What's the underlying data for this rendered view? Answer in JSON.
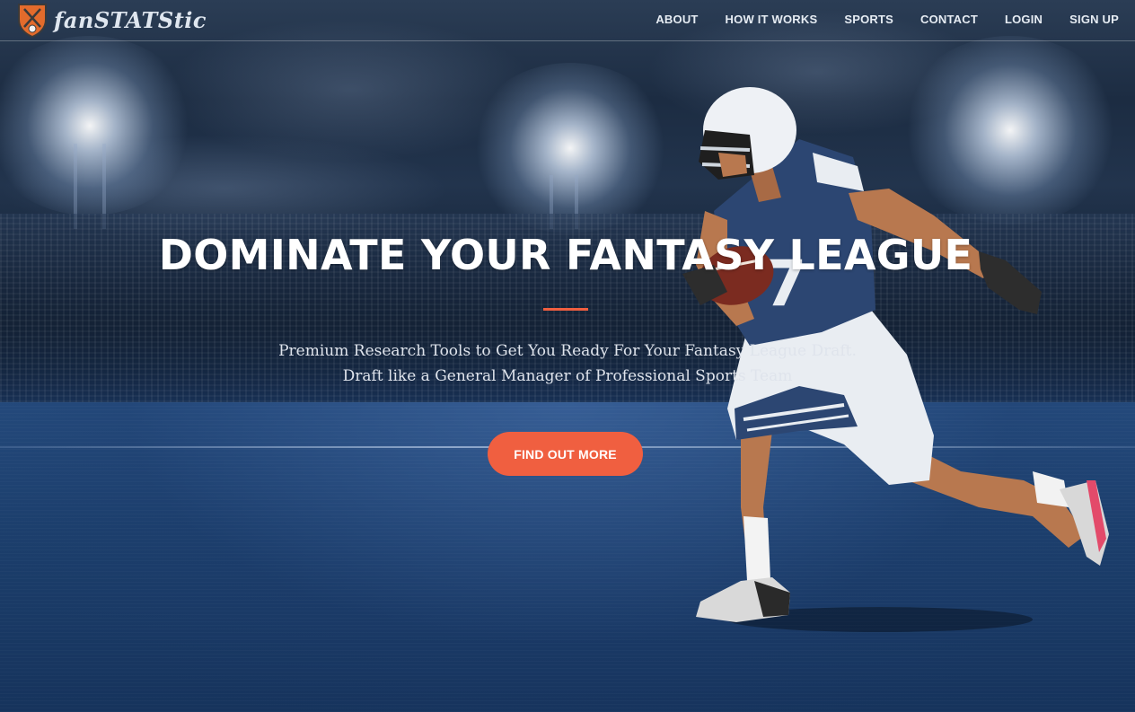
{
  "brand": {
    "name": "fanSTATStic",
    "logo_icon": "crossed-bats-shield-icon",
    "logo_colors": {
      "shield": "#e36b2c",
      "outline": "#3a3a3a"
    }
  },
  "nav": {
    "items": [
      {
        "label": "ABOUT"
      },
      {
        "label": "HOW IT WORKS"
      },
      {
        "label": "SPORTS"
      },
      {
        "label": "CONTACT"
      },
      {
        "label": "LOGIN"
      },
      {
        "label": "SIGN UP"
      }
    ]
  },
  "hero": {
    "headline": "DOMINATE YOUR FANTASY LEAGUE",
    "subtitle_line1": "Premium Research Tools to Get You Ready For Your Fantasy League Draft.",
    "subtitle_line2": "Draft like a General Manager of Professional Sports Team",
    "cta_label": "FIND OUT MORE",
    "background_image": "football-player-running-in-stadium"
  },
  "colors": {
    "accent": "#f05f40",
    "text_light": "#ffffff",
    "background_dark": "#0d1a2c"
  }
}
